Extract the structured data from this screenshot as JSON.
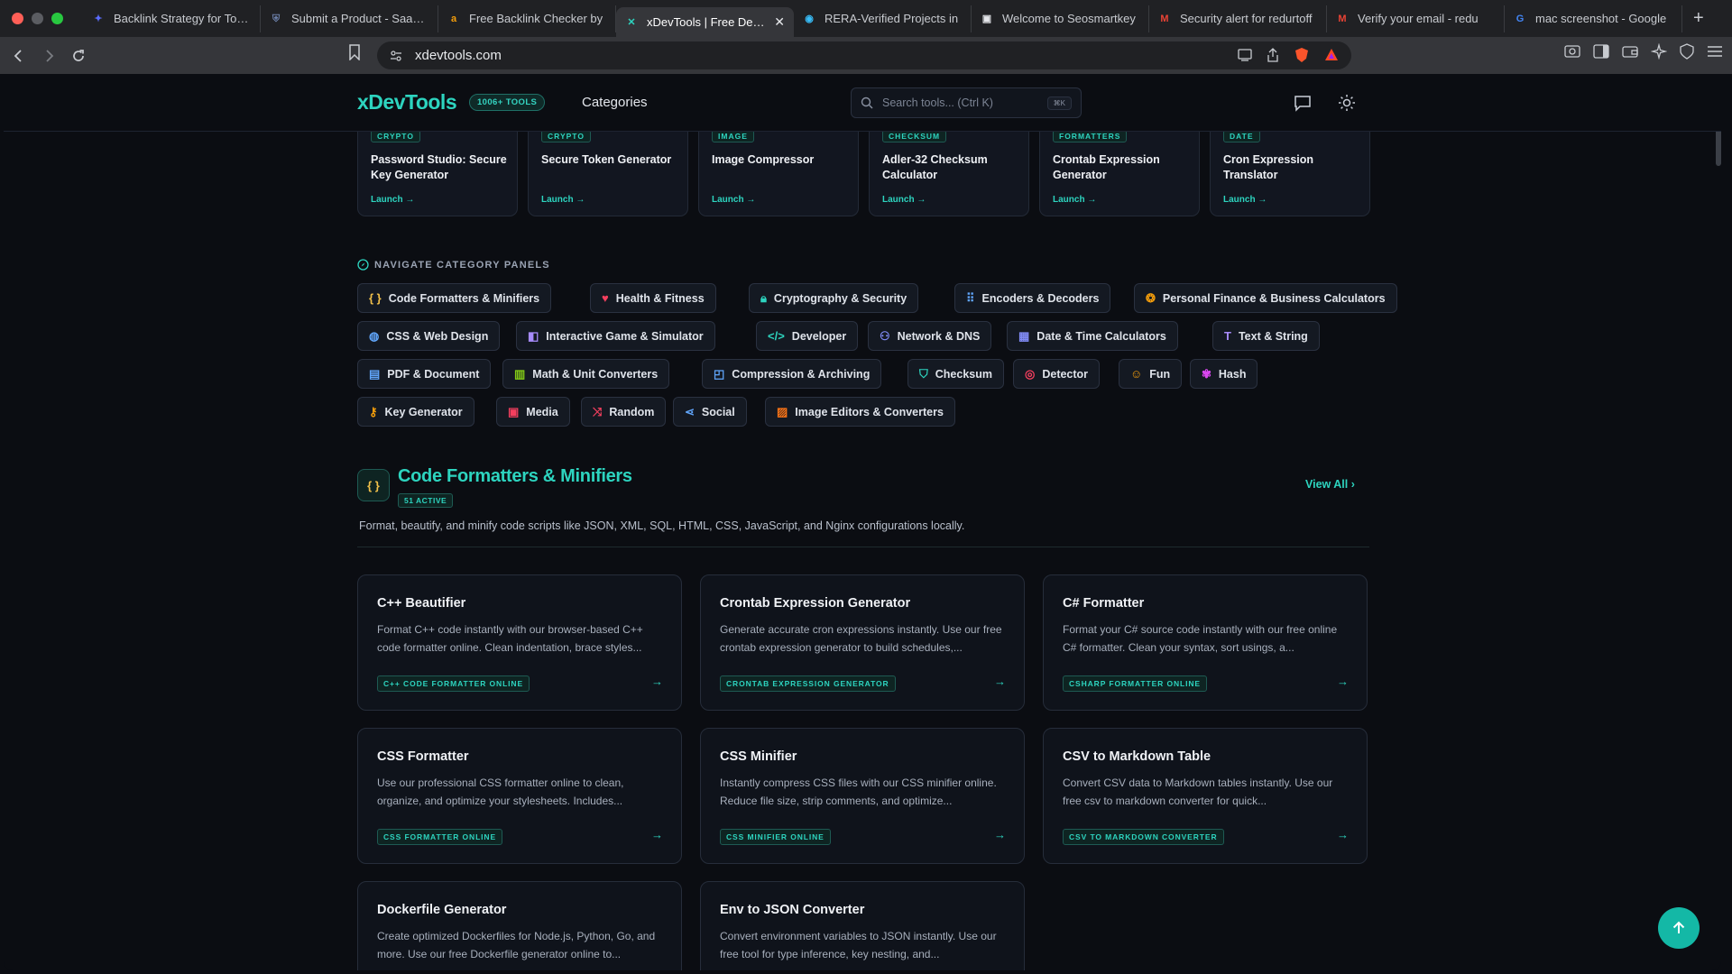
{
  "browser": {
    "tabs": [
      {
        "title": "Backlink Strategy for Tools",
        "fav_color": "#5b6cff",
        "fav": "✦"
      },
      {
        "title": "Submit a Product - SaaSHub",
        "fav_color": "#6b7fa8",
        "fav": "⛨"
      },
      {
        "title": "Free Backlink Checker by",
        "fav_color": "#f59e0b",
        "fav": "a"
      },
      {
        "title": "xDevTools | Free Developer",
        "fav_color": "#2dd4bf",
        "fav": "✕",
        "active": true
      },
      {
        "title": "RERA-Verified Projects in",
        "fav_color": "#38bdf8",
        "fav": "◉"
      },
      {
        "title": "Welcome to Seosmartkey",
        "fav_color": "#e5e7eb",
        "fav": "▣"
      },
      {
        "title": "Security alert for redurtoff",
        "fav_color": "#ea4335",
        "fav": "M"
      },
      {
        "title": "Verify your email - redu",
        "fav_color": "#ea4335",
        "fav": "M"
      },
      {
        "title": "mac screenshot - Google",
        "fav_color": "#4285f4",
        "fav": "G"
      }
    ],
    "url": "xdevtools.com"
  },
  "header": {
    "logo": "xDevTools",
    "tools_badge": "1006+ TOOLS",
    "categories_label": "Categories",
    "search_placeholder": "Search tools... (Ctrl K)",
    "search_kbd": "⌘K"
  },
  "top_cards": [
    {
      "tag": "CRYPTO",
      "title": "Password Studio: Secure Key Generator",
      "launch": "Launch →"
    },
    {
      "tag": "CRYPTO",
      "title": "Secure Token Generator",
      "launch": "Launch →"
    },
    {
      "tag": "IMAGE",
      "title": "Image Compressor",
      "launch": "Launch →"
    },
    {
      "tag": "CHECKSUM",
      "title": "Adler-32 Checksum Calculator",
      "launch": "Launch →"
    },
    {
      "tag": "FORMATTERS",
      "title": "Crontab Expression Generator",
      "launch": "Launch →"
    },
    {
      "tag": "DATE",
      "title": "Cron Expression Translator",
      "launch": "Launch →"
    }
  ],
  "nav_heading": "NAVIGATE CATEGORY PANELS",
  "categories": [
    {
      "label": "Code Formatters & Minifiers",
      "icon": "{ }",
      "color": "#f1c04a"
    },
    {
      "label": "Health & Fitness",
      "icon": "♥",
      "color": "#f43f5e"
    },
    {
      "label": "Cryptography & Security",
      "icon": "🔒︎",
      "color": "#2dd4bf"
    },
    {
      "label": "Encoders & Decoders",
      "icon": "⠿",
      "color": "#60a5fa"
    },
    {
      "label": "Personal Finance & Business Calculators",
      "icon": "❂",
      "color": "#f59e0b"
    },
    {
      "label": "CSS & Web Design",
      "icon": "◍",
      "color": "#60a5fa"
    },
    {
      "label": "Interactive Game & Simulator",
      "icon": "◧",
      "color": "#a78bfa"
    },
    {
      "label": "Developer",
      "icon": "</>",
      "color": "#2dd4bf"
    },
    {
      "label": "Network & DNS",
      "icon": "⚇",
      "color": "#818cf8"
    },
    {
      "label": "Date & Time Calculators",
      "icon": "▦",
      "color": "#818cf8"
    },
    {
      "label": "Text & String",
      "icon": "T",
      "color": "#a78bfa"
    },
    {
      "label": "PDF & Document",
      "icon": "▤",
      "color": "#60a5fa"
    },
    {
      "label": "Math & Unit Converters",
      "icon": "▥",
      "color": "#84cc16"
    },
    {
      "label": "Compression & Archiving",
      "icon": "◰",
      "color": "#60a5fa"
    },
    {
      "label": "Checksum",
      "icon": "⛉",
      "color": "#2dd4bf"
    },
    {
      "label": "Detector",
      "icon": "◎",
      "color": "#f43f5e"
    },
    {
      "label": "Fun",
      "icon": "☺",
      "color": "#f59e0b"
    },
    {
      "label": "Hash",
      "icon": "✾",
      "color": "#d946ef"
    },
    {
      "label": "Key Generator",
      "icon": "⚷",
      "color": "#f59e0b"
    },
    {
      "label": "Media",
      "icon": "▣",
      "color": "#f43f5e"
    },
    {
      "label": "Random",
      "icon": "⤨",
      "color": "#f43f5e"
    },
    {
      "label": "Social",
      "icon": "⋖",
      "color": "#60a5fa"
    },
    {
      "label": "Image Editors & Converters",
      "icon": "▨",
      "color": "#f97316"
    }
  ],
  "section": {
    "icon": "{ }",
    "title": "Code Formatters & Minifiers",
    "badge": "51 ACTIVE",
    "view_all": "View All",
    "description": "Format, beautify, and minify code scripts like JSON, XML, SQL, HTML, CSS, JavaScript, and Nginx configurations locally."
  },
  "tools": [
    {
      "title": "C++ Beautifier",
      "desc": "Format C++ code instantly with our browser-based C++ code formatter online. Clean indentation, brace styles...",
      "keyword": "C++ CODE FORMATTER ONLINE"
    },
    {
      "title": "Crontab Expression Generator",
      "desc": "Generate accurate cron expressions instantly. Use our free crontab expression generator to build schedules,...",
      "keyword": "CRONTAB EXPRESSION GENERATOR"
    },
    {
      "title": "C# Formatter",
      "desc": "Format your C# source code instantly with our free online C# formatter. Clean your syntax, sort usings, a...",
      "keyword": "CSHARP FORMATTER ONLINE"
    },
    {
      "title": "CSS Formatter",
      "desc": "Use our professional CSS formatter online to clean, organize, and optimize your stylesheets. Includes...",
      "keyword": "CSS FORMATTER ONLINE"
    },
    {
      "title": "CSS Minifier",
      "desc": "Instantly compress CSS files with our CSS minifier online. Reduce file size, strip comments, and optimize...",
      "keyword": "CSS MINIFIER ONLINE"
    },
    {
      "title": "CSV to Markdown Table",
      "desc": "Convert CSV data to Markdown tables instantly. Use our free csv to markdown converter for quick...",
      "keyword": "CSV TO MARKDOWN CONVERTER"
    },
    {
      "title": "Dockerfile Generator",
      "desc": "Create optimized Dockerfiles for Node.js, Python, Go, and more. Use our free Dockerfile generator online to...",
      "keyword": ""
    },
    {
      "title": "Env to JSON Converter",
      "desc": "Convert environment variables to JSON instantly. Use our free tool for type inference, key nesting, and...",
      "keyword": ""
    }
  ]
}
